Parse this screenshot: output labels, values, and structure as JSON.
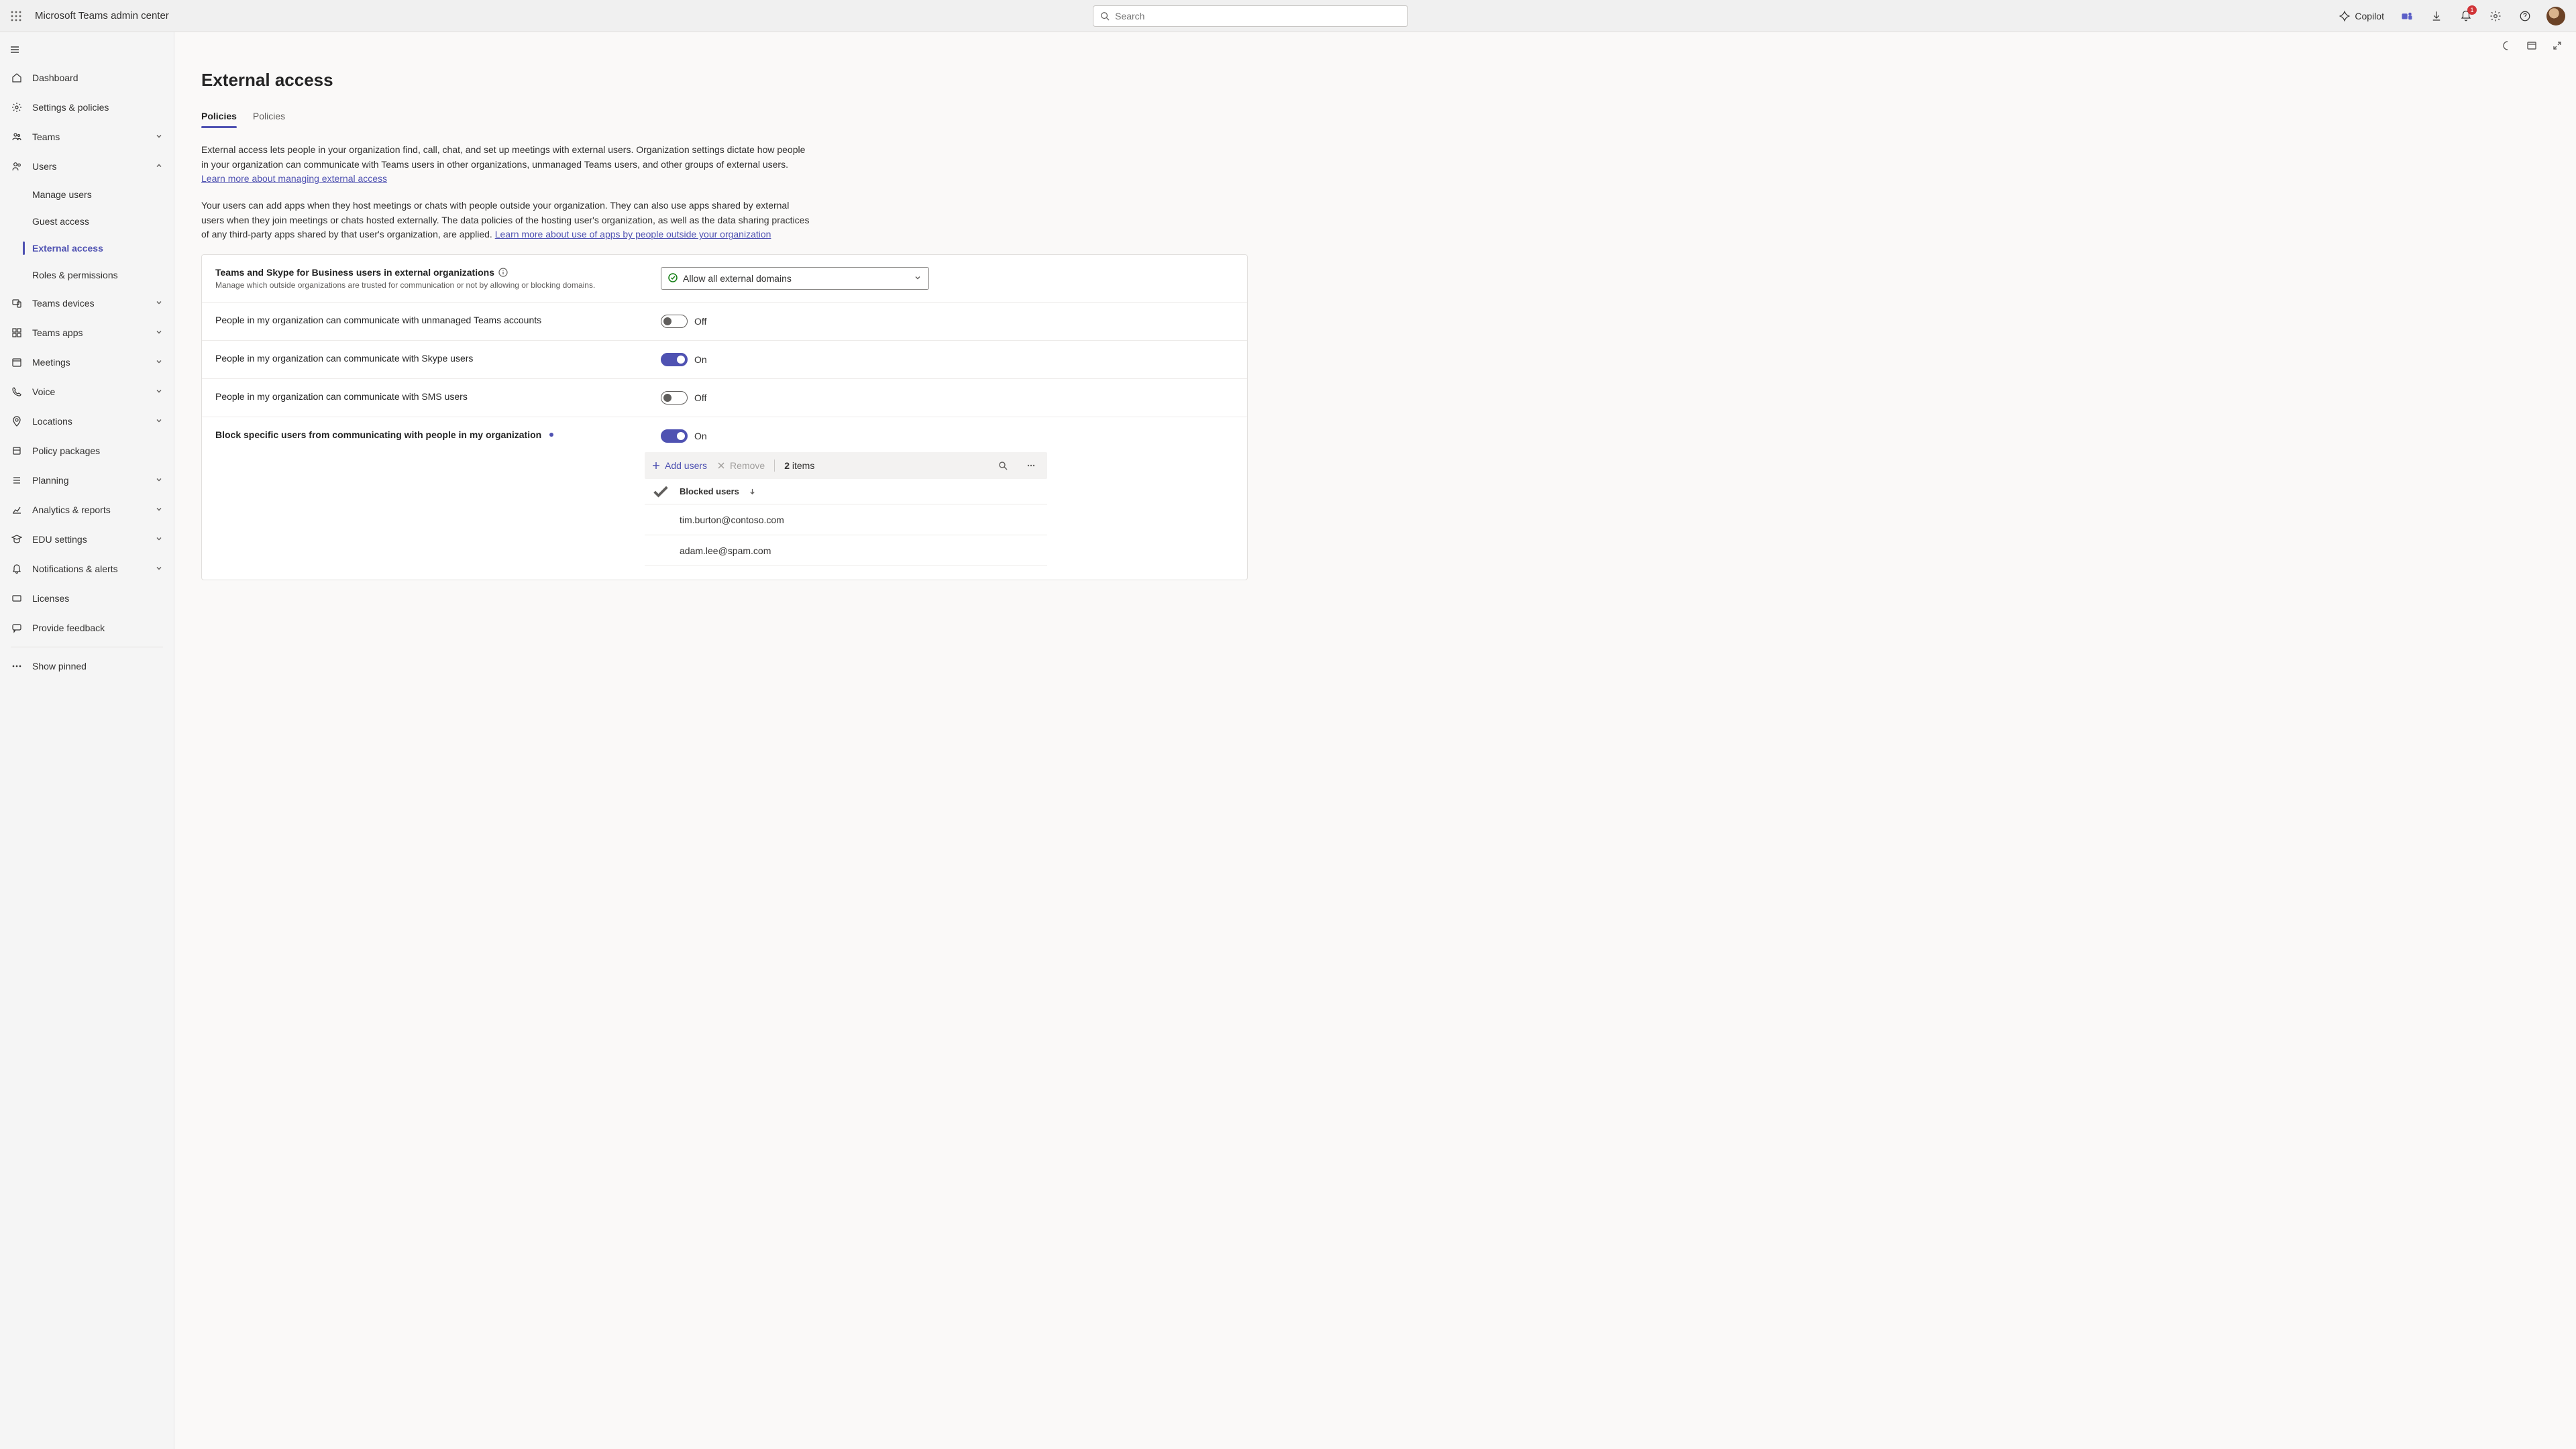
{
  "header": {
    "app_title": "Microsoft Teams admin center",
    "search_placeholder": "Search",
    "copilot_label": "Copilot",
    "notification_count": "1"
  },
  "sidebar": {
    "dashboard": "Dashboard",
    "settings_policies": "Settings & policies",
    "teams": "Teams",
    "users": "Users",
    "manage_users": "Manage users",
    "guest_access": "Guest access",
    "external_access": "External access",
    "roles_permissions": "Roles & permissions",
    "teams_devices": "Teams devices",
    "teams_apps": "Teams apps",
    "meetings": "Meetings",
    "voice": "Voice",
    "locations": "Locations",
    "policy_packages": "Policy packages",
    "planning": "Planning",
    "analytics_reports": "Analytics & reports",
    "edu_settings": "EDU settings",
    "notifications_alerts": "Notifications & alerts",
    "licenses": "Licenses",
    "provide_feedback": "Provide feedback",
    "show_pinned": "Show pinned"
  },
  "page": {
    "title": "External access",
    "tabs": [
      "Policies",
      "Policies"
    ],
    "intro1_a": "External access lets people in your organization find, call, chat, and set up meetings with external users. Organization settings dictate how people in your organization can communicate with Teams users in other organizations, unmanaged Teams users, and other groups of external users. ",
    "intro1_link": "Learn more about managing external access",
    "intro2_a": "Your users can add apps when they host meetings or chats with people outside your organization. They can also use apps shared by external users when they join meetings or chats hosted externally. The data policies of the hosting user's organization, as well as the data sharing practices of any third-party apps shared by that user's organization, are applied. ",
    "intro2_link": "Learn more about use of apps by people outside your organization"
  },
  "settings": {
    "row1": {
      "label": "Teams and Skype for Business users in external organizations",
      "sub": "Manage which outside organizations are trusted for communication or not by allowing or blocking domains.",
      "dropdown_value": "Allow all external domains"
    },
    "row2": {
      "label": "People in my organization can communicate with unmanaged Teams accounts",
      "state_label": "Off"
    },
    "row3": {
      "label": "People in my organization can communicate with Skype users",
      "state_label": "On"
    },
    "row4": {
      "label": "People in my organization can communicate with SMS users",
      "state_label": "Off"
    },
    "row5": {
      "label": "Block specific users from communicating with people in my organization",
      "state_label": "On"
    }
  },
  "blocked_panel": {
    "add_label": "Add users",
    "remove_label": "Remove",
    "count_num": "2",
    "count_word": " items",
    "header": "Blocked users",
    "rows": [
      "tim.burton@contoso.com",
      "adam.lee@spam.com"
    ]
  }
}
